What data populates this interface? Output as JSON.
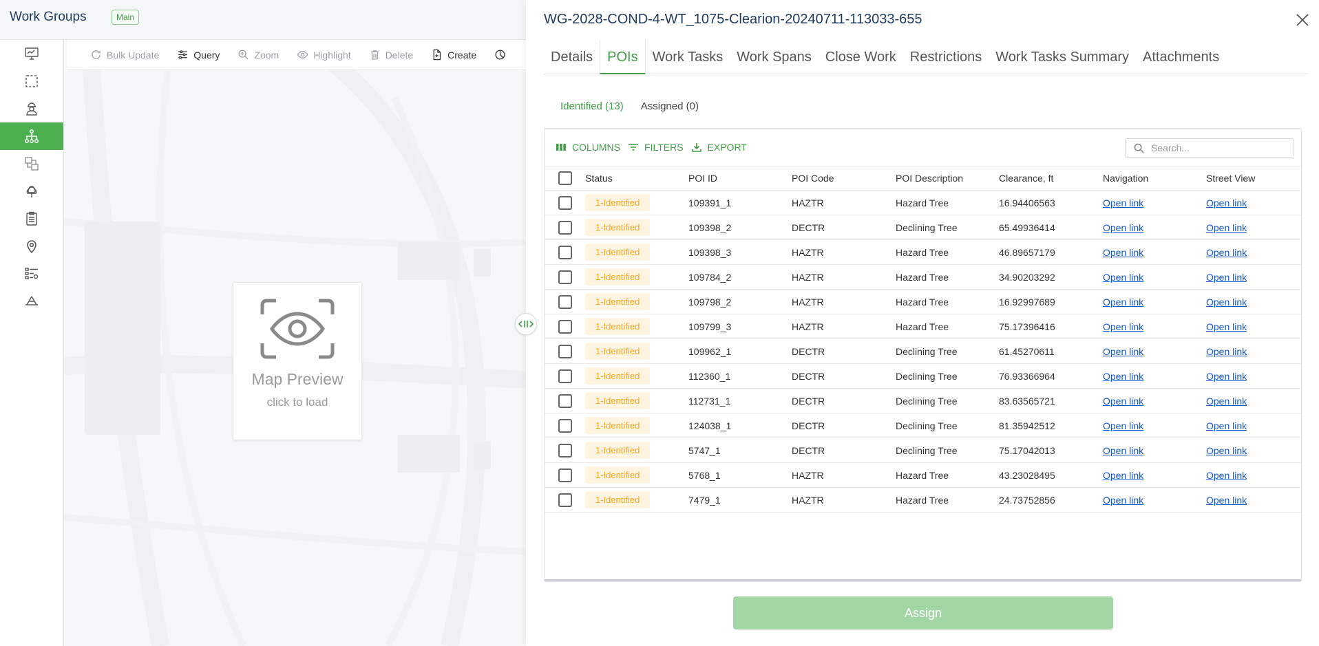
{
  "app": {
    "title": "Work Groups",
    "env_badge": "Main"
  },
  "sidebar": {
    "items": [
      {
        "icon": "monitor-icon",
        "active": false
      },
      {
        "icon": "selection-icon",
        "active": false
      },
      {
        "icon": "worker-icon",
        "active": false
      },
      {
        "icon": "hierarchy-icon",
        "active": true
      },
      {
        "icon": "map-layers-icon",
        "active": false
      },
      {
        "icon": "tree-icon",
        "active": false
      },
      {
        "icon": "clipboard-icon",
        "active": false
      },
      {
        "icon": "location-pin-icon",
        "active": false
      },
      {
        "icon": "list-settings-icon",
        "active": false
      },
      {
        "icon": "powerline-icon",
        "active": false
      }
    ]
  },
  "map_toolbar": {
    "bulk_update": "Bulk Update",
    "query": "Query",
    "zoom": "Zoom",
    "highlight": "Highlight",
    "delete": "Delete",
    "create": "Create"
  },
  "map_preview": {
    "title": "Map Preview",
    "subtitle": "click to load"
  },
  "drawer": {
    "title": "WG-2028-COND-4-WT_1075-Clearion-20240711-113033-655",
    "tabs": [
      "Details",
      "POIs",
      "Work Tasks",
      "Work Spans",
      "Close Work",
      "Restrictions",
      "Work Tasks Summary",
      "Attachments"
    ],
    "active_tab": "POIs",
    "subtabs": {
      "identified": "Identified (13)",
      "assigned": "Assigned (0)"
    },
    "grid_toolbar": {
      "columns": "COLUMNS",
      "filters": "FILTERS",
      "export": "EXPORT",
      "search_placeholder": "Search..."
    },
    "columns": [
      "Status",
      "POI ID",
      "POI Code",
      "POI Description",
      "Clearance, ft",
      "Navigation",
      "Street View"
    ],
    "rows": [
      {
        "status": "1-Identified",
        "poi_id": "109391_1",
        "code": "HAZTR",
        "desc": "Hazard Tree",
        "clearance": "16.94406563",
        "nav": "Open link",
        "street": "Open link"
      },
      {
        "status": "1-Identified",
        "poi_id": "109398_2",
        "code": "DECTR",
        "desc": "Declining Tree",
        "clearance": "65.49936414",
        "nav": "Open link",
        "street": "Open link"
      },
      {
        "status": "1-Identified",
        "poi_id": "109398_3",
        "code": "HAZTR",
        "desc": "Hazard Tree",
        "clearance": "46.89657179",
        "nav": "Open link",
        "street": "Open link"
      },
      {
        "status": "1-Identified",
        "poi_id": "109784_2",
        "code": "HAZTR",
        "desc": "Hazard Tree",
        "clearance": "34.90203292",
        "nav": "Open link",
        "street": "Open link"
      },
      {
        "status": "1-Identified",
        "poi_id": "109798_2",
        "code": "HAZTR",
        "desc": "Hazard Tree",
        "clearance": "16.92997689",
        "nav": "Open link",
        "street": "Open link"
      },
      {
        "status": "1-Identified",
        "poi_id": "109799_3",
        "code": "HAZTR",
        "desc": "Hazard Tree",
        "clearance": "75.17396416",
        "nav": "Open link",
        "street": "Open link"
      },
      {
        "status": "1-Identified",
        "poi_id": "109962_1",
        "code": "DECTR",
        "desc": "Declining Tree",
        "clearance": "61.45270611",
        "nav": "Open link",
        "street": "Open link"
      },
      {
        "status": "1-Identified",
        "poi_id": "112360_1",
        "code": "DECTR",
        "desc": "Declining Tree",
        "clearance": "76.93366964",
        "nav": "Open link",
        "street": "Open link"
      },
      {
        "status": "1-Identified",
        "poi_id": "112731_1",
        "code": "DECTR",
        "desc": "Declining Tree",
        "clearance": "83.63565721",
        "nav": "Open link",
        "street": "Open link"
      },
      {
        "status": "1-Identified",
        "poi_id": "124038_1",
        "code": "DECTR",
        "desc": "Declining Tree",
        "clearance": "81.35942512",
        "nav": "Open link",
        "street": "Open link"
      },
      {
        "status": "1-Identified",
        "poi_id": "5747_1",
        "code": "DECTR",
        "desc": "Declining Tree",
        "clearance": "75.17042013",
        "nav": "Open link",
        "street": "Open link"
      },
      {
        "status": "1-Identified",
        "poi_id": "5768_1",
        "code": "HAZTR",
        "desc": "Hazard Tree",
        "clearance": "43.23028495",
        "nav": "Open link",
        "street": "Open link"
      },
      {
        "status": "1-Identified",
        "poi_id": "7479_1",
        "code": "HAZTR",
        "desc": "Hazard Tree",
        "clearance": "24.73752856",
        "nav": "Open link",
        "street": "Open link"
      }
    ],
    "assign_button": "Assign"
  },
  "colors": {
    "accent_green": "#3f9b44",
    "sidebar_active": "#4caf50",
    "status_chip_bg": "#fff4e0",
    "status_chip_text": "#f5a623",
    "title_navy": "#1f3a5f",
    "assign_disabled": "#a3d6a5"
  }
}
